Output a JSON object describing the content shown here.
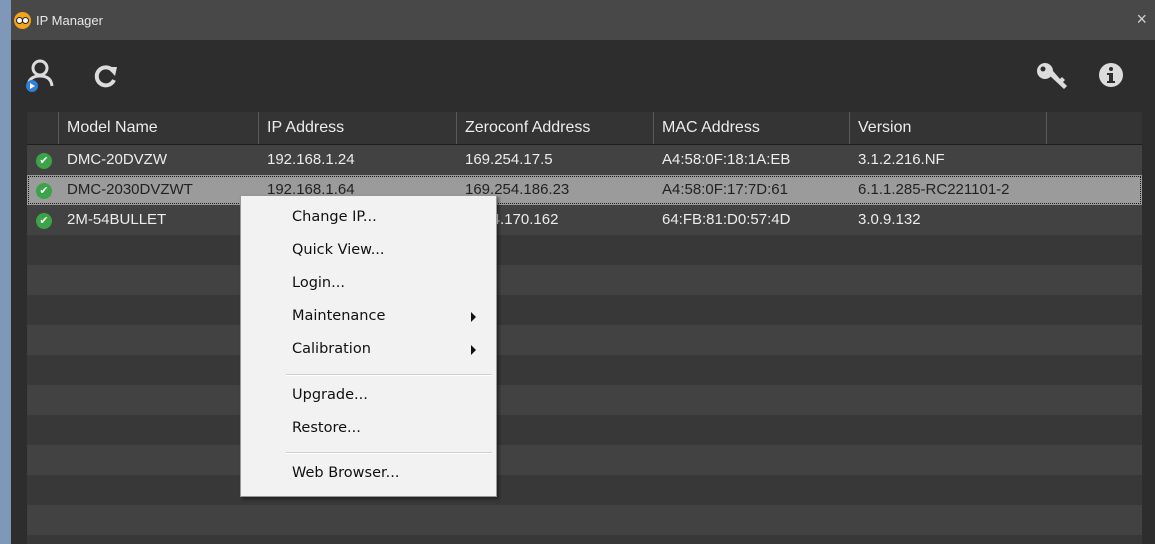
{
  "window": {
    "title": "IP Manager",
    "close_glyph": "×",
    "icon": "app-logo-icon"
  },
  "toolbar": {
    "buttons": [
      "search-devices-icon",
      "refresh-icon",
      "key-icon",
      "info-icon"
    ]
  },
  "table": {
    "columns": [
      "Model Name",
      "IP Address",
      "Zeroconf Address",
      "MAC Address",
      "Version"
    ],
    "rows": [
      {
        "model": "DMC-20DVZW",
        "ip": "192.168.1.24",
        "zeroconf": "169.254.17.5",
        "mac": "A4:58:0F:18:1A:EB",
        "version": "3.1.2.216.NF"
      },
      {
        "model": "DMC-2030DVZWT",
        "ip": "192.168.1.64",
        "zeroconf": "169.254.186.23",
        "mac": "A4:58:0F:17:7D:61",
        "version": "6.1.1.285-RC221101-2"
      },
      {
        "model": "2M-54BULLET",
        "ip": "",
        "zeroconf": "254.170.162",
        "mac": "64:FB:81:D0:57:4D",
        "version": "3.0.9.132"
      }
    ],
    "selected_row": 1,
    "status_icon": "check-icon",
    "colors": {
      "check": "#3aa447",
      "selected_row": "#9b9b9b"
    }
  },
  "context_menu": {
    "items": [
      "Change IP...",
      "Quick View...",
      "Login...",
      "Maintenance",
      "Calibration",
      "Upgrade...",
      "Restore...",
      "Web Browser..."
    ]
  }
}
